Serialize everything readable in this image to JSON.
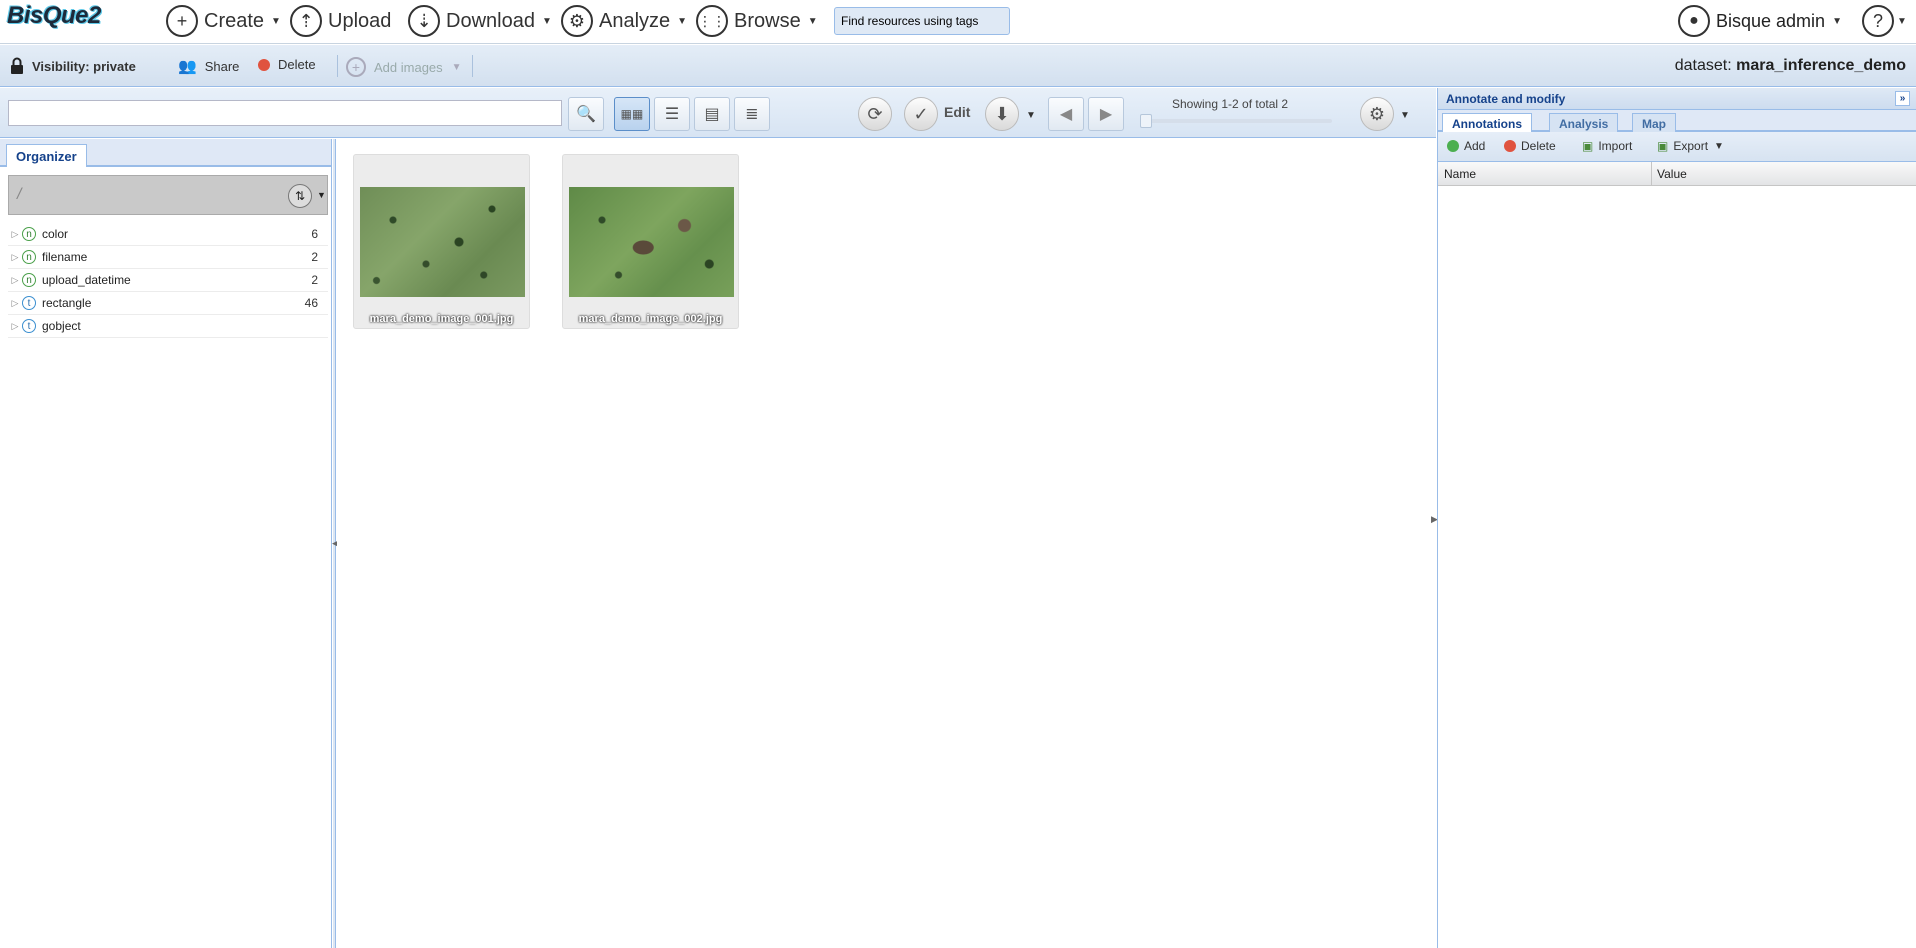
{
  "app": {
    "logo": "BisQue2"
  },
  "topnav": {
    "create": "Create",
    "upload": "Upload",
    "download": "Download",
    "analyze": "Analyze",
    "browse": "Browse",
    "tag_search_placeholder": "Find resources using tags",
    "user": "Bisque admin",
    "help": "?"
  },
  "dataset_toolbar": {
    "visibility": "Visibility: private",
    "share": "Share",
    "delete": "Delete",
    "add_images": "Add images",
    "dataset_prefix": "dataset:",
    "dataset_name": "mara_inference_demo"
  },
  "browser_toolbar": {
    "search_value": "",
    "edit": "Edit",
    "showing": "Showing 1-2 of total 2"
  },
  "organizer": {
    "tab": "Organizer",
    "path": "/",
    "items": [
      {
        "type": "n",
        "name": "color",
        "count": "6"
      },
      {
        "type": "n",
        "name": "filename",
        "count": "2"
      },
      {
        "type": "n",
        "name": "upload_datetime",
        "count": "2"
      },
      {
        "type": "t",
        "name": "rectangle",
        "count": "46"
      },
      {
        "type": "t",
        "name": "gobject",
        "count": ""
      }
    ]
  },
  "thumbnails": [
    {
      "label": "mara_demo_image_001.jpg"
    },
    {
      "label": "mara_demo_image_002.jpg"
    }
  ],
  "right_panel": {
    "title": "Annotate and modify",
    "tabs": [
      "Annotations",
      "Analysis",
      "Map"
    ],
    "add": "Add",
    "delete": "Delete",
    "import": "Import",
    "export": "Export",
    "col_name": "Name",
    "col_value": "Value"
  }
}
